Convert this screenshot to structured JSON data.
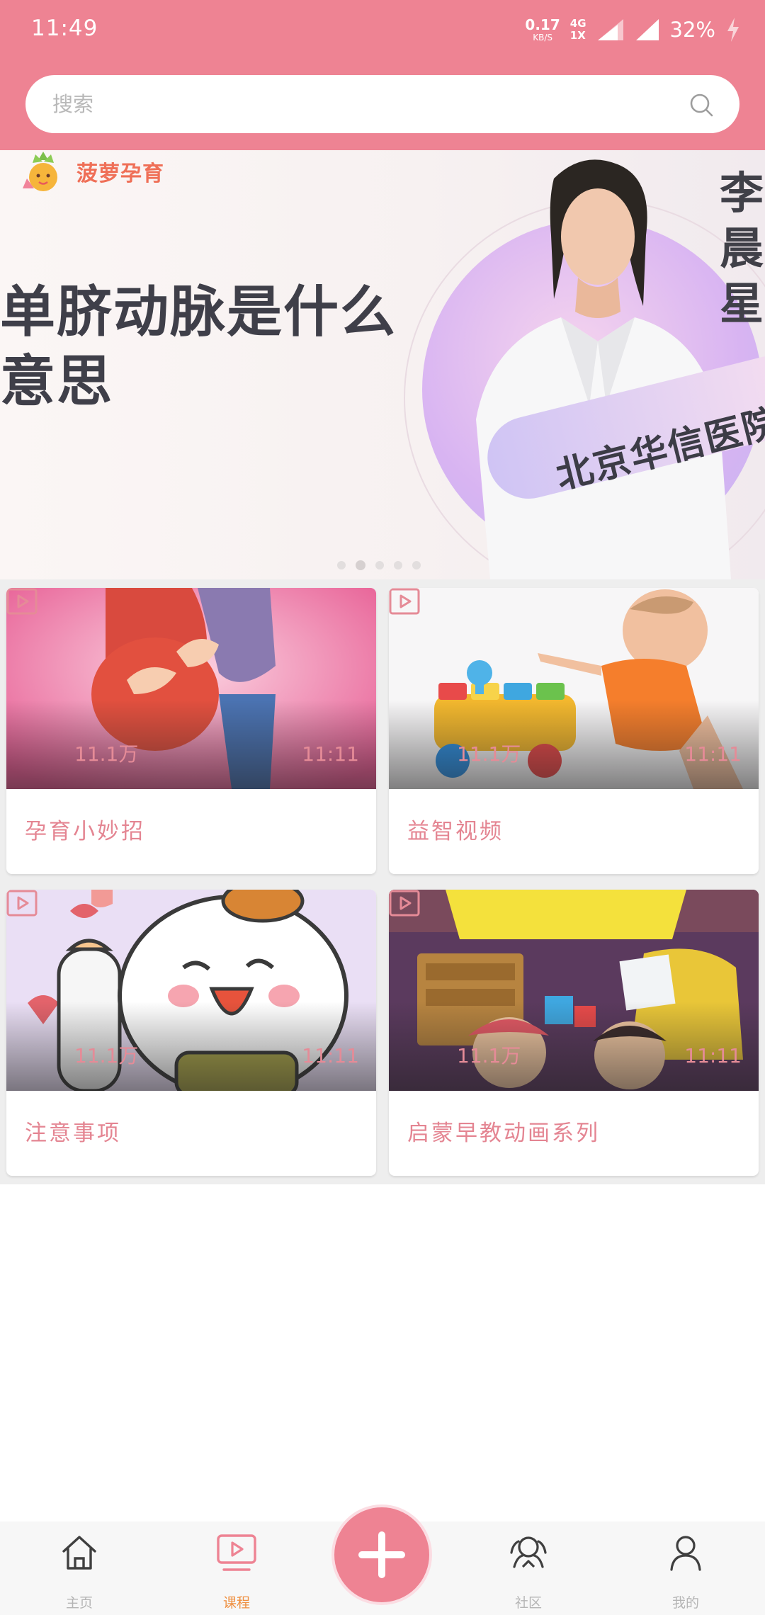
{
  "status_bar": {
    "time": "11:49",
    "net_speed_value": "0.17",
    "net_speed_unit": "KB/S",
    "net_type_top": "4G",
    "net_type_bottom": "1X",
    "battery": "32%"
  },
  "search": {
    "placeholder": "搜索",
    "value": ""
  },
  "banner": {
    "brand": "菠萝孕育",
    "headline_line1": "单脐动脉是什么",
    "headline_line2": "意思",
    "doctor_name": [
      "李",
      "晨",
      "星"
    ],
    "hospital": "北京华信医院",
    "slide_count": 5,
    "active_slide": 2
  },
  "courses": [
    {
      "title": "孕育小妙招",
      "views": "11.1万",
      "duration": "11:11"
    },
    {
      "title": "益智视频",
      "views": "11.1万",
      "duration": "11:11"
    },
    {
      "title": "注意事项",
      "views": "11.1万",
      "duration": "11:11"
    },
    {
      "title": "启蒙早教动画系列",
      "views": "11.1万",
      "duration": "11:11"
    }
  ],
  "bottom_nav": {
    "items": [
      {
        "label": "主页",
        "icon": "home-icon",
        "active": false
      },
      {
        "label": "课程",
        "icon": "video-course-icon",
        "active": true
      },
      {
        "label": "社区",
        "icon": "community-icon",
        "active": false
      },
      {
        "label": "我的",
        "icon": "profile-icon",
        "active": false
      }
    ],
    "center_action_icon": "plus-icon"
  },
  "colors": {
    "brand_pink": "#ee8393",
    "title_pink": "#e48592",
    "active_tab": "#ef8f3f"
  }
}
